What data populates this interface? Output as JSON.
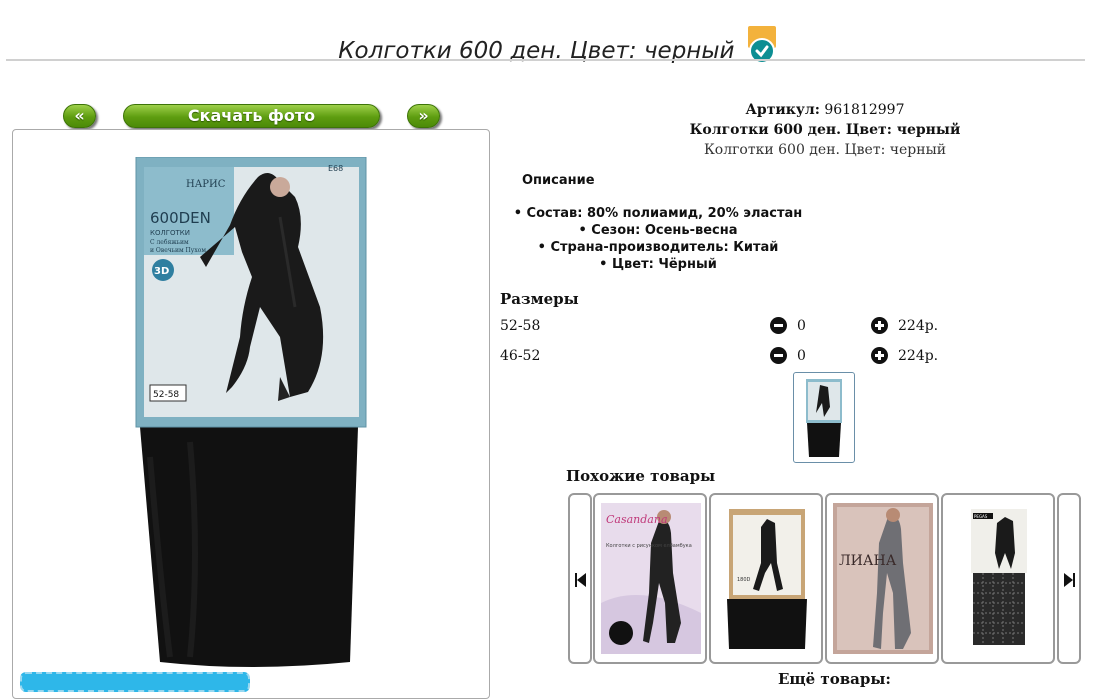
{
  "page": {
    "title": "Колготки 600 ден. Цвет: черный",
    "badge_icon": "check-badge-icon"
  },
  "photo_nav": {
    "prev_label": "«",
    "download_label": "Скачать фото",
    "next_label": "»"
  },
  "product": {
    "article_label": "Артикул:",
    "article_value": "961812997",
    "name_bold": "Колготки 600 ден. Цвет: черный",
    "name_plain": "Колготки 600 ден. Цвет: черный"
  },
  "description": {
    "heading": "Описание",
    "items": [
      "Состав: 80% полиамид, 20% эластан",
      "Сезон: Осень-весна",
      "Страна-производитель: Китай",
      "Цвет: Чёрный"
    ]
  },
  "sizes": {
    "heading": "Размеры",
    "rows": [
      {
        "size": "52-58",
        "qty": "0",
        "price": "224р."
      },
      {
        "size": "46-52",
        "qty": "0",
        "price": "224р."
      }
    ]
  },
  "package": {
    "brand": "НАРИС",
    "code": "E68",
    "den": "600DEN",
    "line1": "КОЛГОТКИ",
    "line2": "С лебяжьим",
    "line3": "и Овечьим Пухом",
    "tag3d": "3D",
    "size": "52-58"
  },
  "similar": {
    "heading": "Похожие товары",
    "cards": [
      {
        "brand": "Casandana",
        "text": "Колготки с рисунком елбамбука"
      },
      {
        "brand": "",
        "text": "180D"
      },
      {
        "brand": "ЛИАНА",
        "text": ""
      },
      {
        "brand": "PEGAS",
        "text": ""
      }
    ]
  },
  "more": {
    "heading": "Ещё товары:"
  }
}
